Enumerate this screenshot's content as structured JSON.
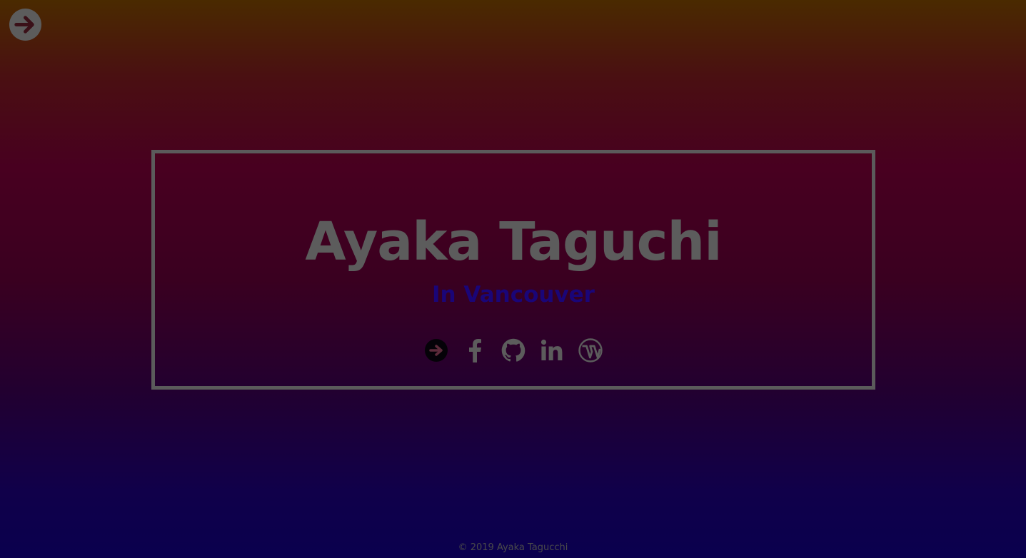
{
  "menu_toggle": {
    "icon": "arrow-right-circle-icon"
  },
  "hero": {
    "name": "Ayaka Taguchi",
    "subtitle": "In Vancouver"
  },
  "socials": [
    {
      "icon": "arrow-right-circle-icon"
    },
    {
      "icon": "facebook-icon"
    },
    {
      "icon": "github-icon"
    },
    {
      "icon": "linkedin-icon"
    },
    {
      "icon": "wordpress-icon"
    }
  ],
  "footer": {
    "copyright": "© 2019 Ayaka Tagucchi"
  },
  "colors": {
    "icon_gray": "#5c5c5c",
    "subtitle_blue": "#1a0578",
    "border_gray": "#5b5b5b"
  }
}
